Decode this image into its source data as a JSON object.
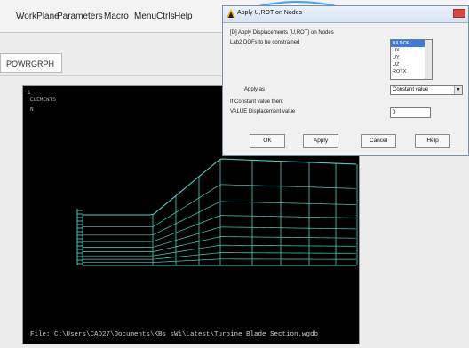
{
  "menu": {
    "items": [
      "WorkPlane",
      "Parameters",
      "Macro",
      "MenuCtrls",
      "Help"
    ],
    "underline_chars": [
      "W",
      "a",
      "M",
      "n",
      "H"
    ]
  },
  "toolbar": {
    "powrgrph": "POWRGRPH"
  },
  "graphics": {
    "index": "1",
    "label": "ELEMENTS",
    "sublabel": "N",
    "file_path": "File: C:\\Users\\CAD27\\Documents\\KBs_sWi\\Latest\\Turbine Blade Section.wgdb"
  },
  "dialog": {
    "title": "Apply U,ROT on Nodes",
    "header": "[D]  Apply Displacements (U,ROT) on Nodes",
    "lab2_label": "Lab2   DOFs to be constrained",
    "dof_options": [
      "All DOF",
      "UX",
      "UY",
      "UZ",
      "ROTX"
    ],
    "dof_selected": "All DOF",
    "apply_as_label": "Apply as",
    "apply_as_value": "Constant value",
    "note": "If Constant value then:",
    "value_label": "VALUE   Displacement value",
    "value": "0",
    "buttons": {
      "ok": "OK",
      "apply": "Apply",
      "cancel": "Cancel",
      "help": "Help"
    }
  },
  "colors": {
    "mesh": "#49d3c4",
    "background": "#000000",
    "dialog_bg": "#f0f0f0",
    "selection": "#3a7be0"
  }
}
